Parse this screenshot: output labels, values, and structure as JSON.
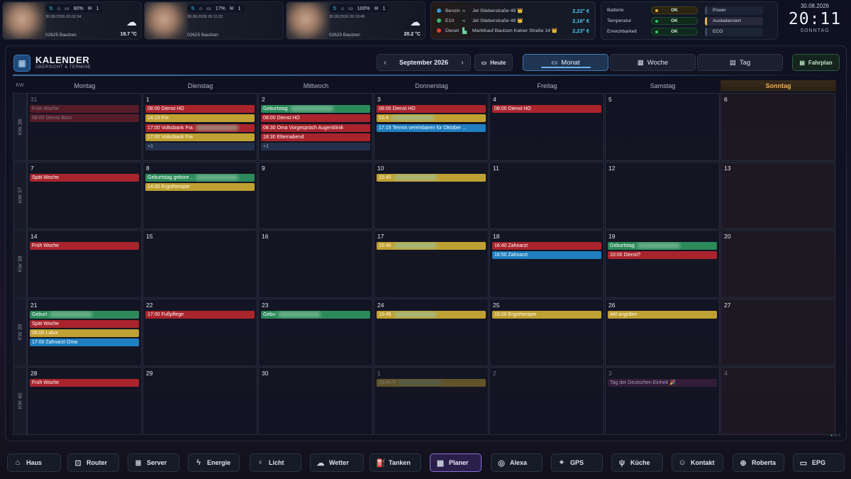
{
  "persons": [
    {
      "battery": "80%",
      "msgs": "1",
      "updated": "30.08.2026 20:02:34",
      "place": "02625 Bautzen",
      "temp": "19.7 °C"
    },
    {
      "battery": "17%",
      "msgs": "1",
      "updated": "30.08.2026 20:11:22",
      "place": "02625 Bautzen",
      "temp": ""
    },
    {
      "battery": "100%",
      "msgs": "1",
      "updated": "30.08.2026 20:10:45",
      "place": "02625 Bautzen",
      "temp": "20.2 °C"
    }
  ],
  "fuel": [
    {
      "type": "Benzin",
      "addr": "Jet Stieberstraße 49 👑",
      "price": "2,22° €",
      "dot": "#2aa0e0"
    },
    {
      "type": "E10",
      "addr": "Jet Stieberstraße 49 👑",
      "price": "2,16° €",
      "dot": "#30c070"
    },
    {
      "type": "Diesel",
      "addr": "Marktkauf Bautzen Kainer Straße 14 👑",
      "price": "2,23° €",
      "dot": "#e04030"
    }
  ],
  "sys": [
    {
      "label": "Batterie",
      "status": "OK",
      "mode": "Power"
    },
    {
      "label": "Temperatur",
      "status": "OK",
      "mode": "Ausbalanciert"
    },
    {
      "label": "Erreichbarkeit",
      "status": "OK",
      "mode": "ECO"
    }
  ],
  "clock": {
    "date": "30.08.2026",
    "time": "20:11",
    "day": "SONNTAG"
  },
  "calendar": {
    "title": "KALENDER",
    "subtitle": "ÜBERSICHT & TERMINE",
    "month": "September 2026",
    "today": "Heute",
    "view_month": "Monat",
    "view_week": "Woche",
    "view_day": "Tag",
    "plan": "Fahrplan",
    "kw_label": "KW",
    "days": [
      "Montag",
      "Dienstag",
      "Mittwoch",
      "Donnerstag",
      "Freitag",
      "Samstag",
      "Sonntag"
    ],
    "weeks": [
      "KW 36",
      "KW 37",
      "KW 38",
      "KW 39",
      "KW 40"
    ],
    "footer": "v1.6"
  },
  "cells": [
    [
      {
        "d": "31",
        "o": 1,
        "e": [
          [
            "red",
            "Früh Woche",
            1
          ],
          [
            "red",
            "08:00 Dienst Büro",
            1
          ]
        ]
      },
      {
        "d": "1",
        "e": [
          [
            "red",
            "08:00 Dienst HO"
          ],
          [
            "yel",
            "14:15 Fre"
          ],
          [
            "red",
            "17:00 Volksbank Fra"
          ],
          [
            "yel",
            "17:00 Volksbank Fra"
          ],
          [
            "more",
            "+1"
          ]
        ]
      },
      {
        "d": "2",
        "e": [
          [
            "grn",
            "Geburtstag"
          ],
          [
            "red",
            "08:00 Dienst HO"
          ],
          [
            "red",
            "08:30 Oma Vorgespräch Augenklinik"
          ],
          [
            "red",
            "18:30 Elternabend"
          ],
          [
            "more",
            "+1"
          ]
        ]
      },
      {
        "d": "3",
        "e": [
          [
            "red",
            "08:00 Dienst HO"
          ],
          [
            "yel",
            "15:4"
          ],
          [
            "blu",
            "17:15 Termin vereinbaren für Oktober ..."
          ]
        ]
      },
      {
        "d": "4",
        "e": [
          [
            "red",
            "08:00 Dienst HO"
          ]
        ]
      },
      {
        "d": "5",
        "e": []
      },
      {
        "d": "6",
        "e": []
      }
    ],
    [
      {
        "d": "7",
        "e": [
          [
            "red",
            "Spät Woche"
          ]
        ]
      },
      {
        "d": "8",
        "e": [
          [
            "grn",
            "Geburtstag                    gebore..."
          ],
          [
            "yel",
            "14:00 Ergotherapie"
          ]
        ]
      },
      {
        "d": "9",
        "e": []
      },
      {
        "d": "10",
        "e": [
          [
            "yel",
            "15:45"
          ]
        ]
      },
      {
        "d": "11",
        "e": []
      },
      {
        "d": "12",
        "e": []
      },
      {
        "d": "13",
        "e": []
      }
    ],
    [
      {
        "d": "14",
        "e": [
          [
            "red",
            "Früh Woche"
          ]
        ]
      },
      {
        "d": "15",
        "e": []
      },
      {
        "d": "16",
        "e": []
      },
      {
        "d": "17",
        "e": [
          [
            "yel",
            "15:45"
          ]
        ]
      },
      {
        "d": "18",
        "e": [
          [
            "red",
            "16:40 Zahnarzt"
          ],
          [
            "blu",
            "16:50 Zahnarzt"
          ]
        ]
      },
      {
        "d": "19",
        "e": [
          [
            "grn",
            "Geburtstag"
          ],
          [
            "red",
            "10:00 Dienst?"
          ]
        ]
      },
      {
        "d": "20",
        "e": []
      }
    ],
    [
      {
        "d": "21",
        "e": [
          [
            "grn",
            "Geburt"
          ],
          [
            "red",
            "Spät Woche"
          ],
          [
            "yel",
            "08:00 Labor"
          ],
          [
            "blu",
            "17:00 Zahnarzt Oma"
          ]
        ]
      },
      {
        "d": "22",
        "e": [
          [
            "red",
            "17:00 Fußpflege"
          ]
        ]
      },
      {
        "d": "23",
        "e": [
          [
            "grn",
            "Gebu"
          ]
        ]
      },
      {
        "d": "24",
        "e": [
          [
            "yel",
            "15:45"
          ]
        ]
      },
      {
        "d": "25",
        "e": [
          [
            "yel",
            "15:00 Ergotherapie"
          ]
        ]
      },
      {
        "d": "26",
        "e": [
          [
            "yel",
            "Akf angrillen"
          ]
        ]
      },
      {
        "d": "27",
        "e": []
      }
    ],
    [
      {
        "d": "28",
        "e": [
          [
            "red",
            "Früh Woche"
          ]
        ]
      },
      {
        "d": "29",
        "e": []
      },
      {
        "d": "30",
        "e": []
      },
      {
        "d": "1",
        "o": 1,
        "e": [
          [
            "yel",
            "15:45 P",
            1
          ]
        ]
      },
      {
        "d": "2",
        "o": 1,
        "e": []
      },
      {
        "d": "3",
        "o": 1,
        "e": [
          [
            "purple",
            "Tag der Deutschen Einheit 🎉"
          ]
        ]
      },
      {
        "d": "4",
        "o": 1,
        "e": []
      }
    ]
  ],
  "nav": [
    {
      "label": "Haus",
      "icon": "⌂"
    },
    {
      "label": "Router",
      "icon": "⊡"
    },
    {
      "label": "Server",
      "icon": "≣"
    },
    {
      "label": "Energie",
      "icon": "ϟ"
    },
    {
      "label": "Licht",
      "icon": "♀"
    },
    {
      "label": "Wetter",
      "icon": "☁"
    },
    {
      "label": "Tanken",
      "icon": "⛽"
    },
    {
      "label": "Planer",
      "icon": "▦",
      "active": true
    },
    {
      "label": "Alexa",
      "icon": "◎"
    },
    {
      "label": "GPS",
      "icon": "⌖"
    },
    {
      "label": "Küche",
      "icon": "ψ"
    },
    {
      "label": "Kontakt",
      "icon": "☺"
    },
    {
      "label": "Roberta",
      "icon": "⊕"
    },
    {
      "label": "EPG",
      "icon": "▭"
    }
  ]
}
